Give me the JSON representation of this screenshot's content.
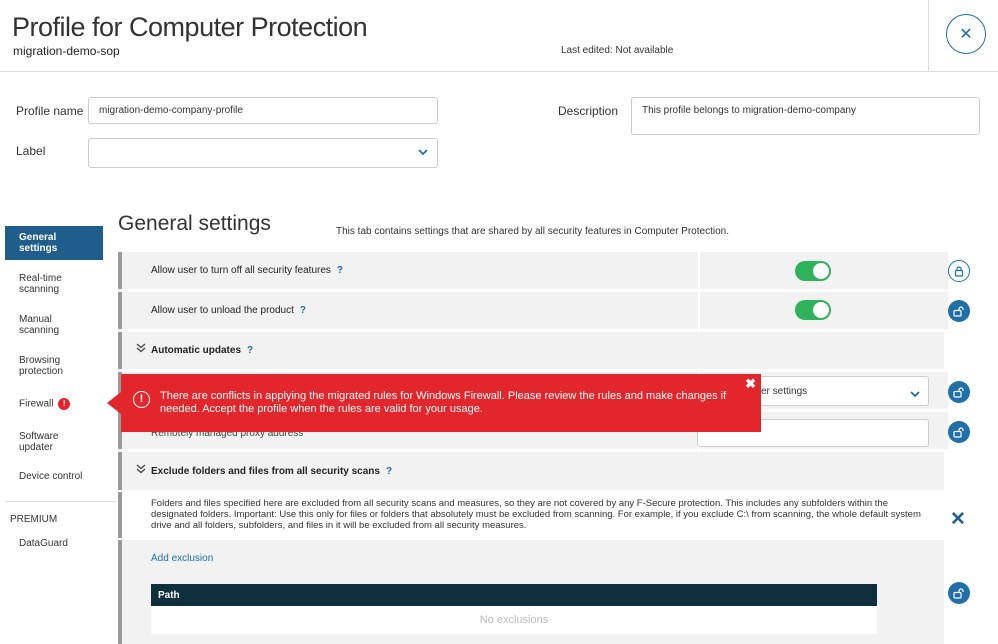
{
  "header": {
    "title": "Profile for Computer Protection",
    "subtitle": "migration-demo-sop",
    "last_edited": "Last edited: Not available",
    "close_symbol": "✕"
  },
  "form": {
    "profile_name_label": "Profile name",
    "profile_name_value": "migration-demo-company-profile",
    "label_label": "Label",
    "label_value": "",
    "description_label": "Description",
    "description_value": "This profile belongs to migration-demo-company"
  },
  "sidebar": {
    "items": [
      {
        "label": "General settings",
        "active": true
      },
      {
        "label": "Real-time scanning"
      },
      {
        "label": "Manual scanning"
      },
      {
        "label": "Browsing protection"
      },
      {
        "label": "Firewall",
        "badge": "!"
      },
      {
        "label": "Software updater"
      },
      {
        "label": "Device control"
      }
    ],
    "premium_heading": "PREMIUM",
    "premium_items": [
      {
        "label": "DataGuard"
      }
    ]
  },
  "main": {
    "section_title": "General settings",
    "section_desc": "This tab contains settings that are shared by all security features in Computer Protection.",
    "rows": [
      {
        "label": "Allow user to turn off all security features",
        "help": "?",
        "toggle_on": true,
        "locked": false
      },
      {
        "label": "Allow user to unload the product",
        "help": "?",
        "toggle_on": true,
        "locked": true
      }
    ],
    "auto_updates": {
      "label": "Automatic updates",
      "help": "?"
    },
    "proxy_select_text": "er settings",
    "proxy_label": "Remotely managed proxy address",
    "exclude": {
      "label": "Exclude folders and files from all security scans",
      "help": "?",
      "description": "Folders and files specified here are excluded from all security scans and measures, so they are not covered by any F-Secure protection. This includes any subfolders within the designated folders. Important: Use this only for files or folders that absolutely must be excluded from scanning. For example, if you exclude C:\\ from scanning, the whole default system drive and all folders, subfolders, and files in it will be excluded from all security measures.",
      "add_label": "Add exclusion",
      "table_header": "Path",
      "empty_text": "No exclusions"
    }
  },
  "error_banner": {
    "icon": "!",
    "text": "There are conflicts in applying the migrated rules for Windows Firewall. Please review the rules and make changes if needed. Accept the profile when the rules are valid for your usage.",
    "close": "✖"
  },
  "colors": {
    "accent": "#1a6fa8",
    "active_nav": "#1f5e8c",
    "toggle_on": "#2eb35a",
    "error": "#e3262b",
    "table_header": "#0e2f3b"
  }
}
